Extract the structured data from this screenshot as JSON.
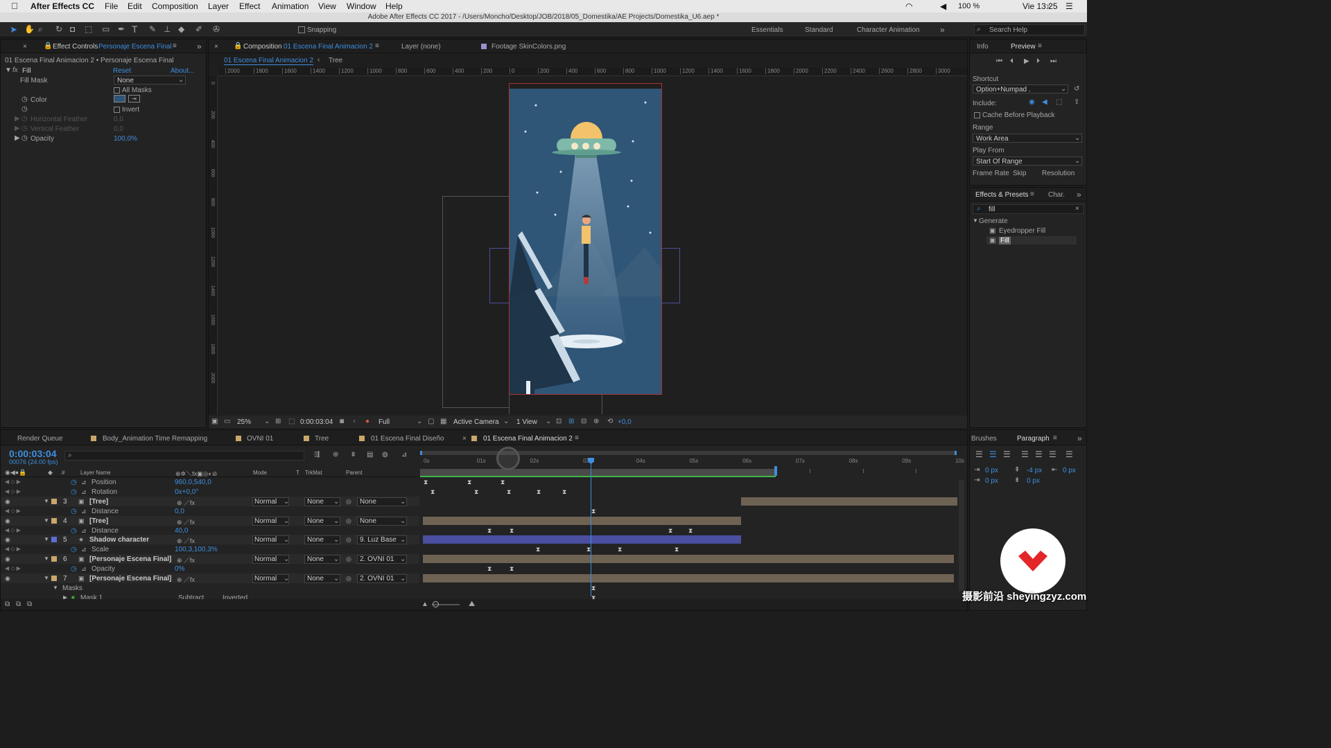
{
  "menubar": {
    "apple": "",
    "app": "After Effects CC",
    "items": [
      "File",
      "Edit",
      "Composition",
      "Layer",
      "Effect",
      "Animation",
      "View",
      "Window",
      "Help"
    ],
    "battery": "100 %",
    "clock": "Vie 13:25"
  },
  "titlebar": {
    "text": "Adobe After Effects CC 2017 - /Users/Moncho/Desktop/JOB/2018/05_Domestika/AE Projects/Domestika_U6.aep *"
  },
  "toolbar": {
    "snapping": "Snapping",
    "workspaces": [
      "Essentials",
      "Standard",
      "Character Animation"
    ],
    "search": "Search Help"
  },
  "effect_controls": {
    "tab_prefix": "Effect Controls",
    "tab_layer": "Personaje Escena Final",
    "breadcrumb": "01 Escena Final Animacion 2 • Personaje Escena Final",
    "fx_name": "Fill",
    "reset": "Reset",
    "about": "About...",
    "props": [
      {
        "label": "Fill Mask",
        "value": "None"
      },
      {
        "label": "All Masks"
      },
      {
        "label": "Color"
      },
      {
        "label": "Invert"
      },
      {
        "label": "Horizontal Feather",
        "value": "0,0"
      },
      {
        "label": "Vertical Feather",
        "value": "0,0"
      },
      {
        "label": "Opacity",
        "value": "100,0%"
      }
    ]
  },
  "comp_viewer": {
    "tab_prefix": "Composition",
    "tab_comp": "01 Escena Final Animacion 2",
    "layer_tab": "Layer (none)",
    "footage_tab": "Footage SkinColors.png",
    "breadcrumb_active": "01 Escena Final Animacion 2",
    "breadcrumb_next": "Tree",
    "ruler_labels": [
      "2000",
      "1800",
      "1600",
      "1400",
      "1200",
      "1000",
      "800",
      "600",
      "400",
      "200",
      "0",
      "200",
      "400",
      "600",
      "800",
      "1000",
      "1200",
      "1400",
      "1600",
      "1800",
      "2000",
      "2200",
      "2400",
      "2600",
      "2800",
      "3000"
    ],
    "vruler_labels": [
      "0",
      "200",
      "400",
      "600",
      "800",
      "1000",
      "1200",
      "1400",
      "1600",
      "1800",
      "2000"
    ],
    "zoom": "25%",
    "timecode": "0:00:03:04",
    "resolution": "Full",
    "camera": "Active Camera",
    "views": "1 View",
    "exposure": "+0,0"
  },
  "info_panel": {
    "tabs": [
      "Info",
      "Preview"
    ],
    "shortcut_label": "Shortcut",
    "shortcut_value": "Option+Numpad .",
    "include_label": "Include:",
    "cache": "Cache Before Playback",
    "range_label": "Range",
    "range_value": "Work Area",
    "playfrom_label": "Play From",
    "playfrom_value": "Start Of Range",
    "framerate": "Frame Rate",
    "skip": "Skip",
    "resolution": "Resolution"
  },
  "effects_presets": {
    "tab": "Effects & Presets",
    "tab2": "Char.",
    "search_value": "fill",
    "group": "Generate",
    "items": [
      "Eyedropper Fill",
      "Fill"
    ]
  },
  "timeline": {
    "tabs": [
      "Render Queue",
      "Body_Animation Time Remapping",
      "OVNI 01",
      "Tree",
      "01 Escena Final Diseño",
      "01 Escena Final Animacion 2"
    ],
    "timecode": "0:00:03:04",
    "frames": "00076 (24.00 fps)",
    "headers": {
      "layer_name": "Layer Name",
      "mode": "Mode",
      "t": "T",
      "trkmat": "TrkMat",
      "parent": "Parent"
    },
    "ticks": [
      "0s",
      "01s",
      "02s",
      "03s",
      "04s",
      "05s",
      "06s",
      "07s",
      "08s",
      "09s",
      "10s"
    ],
    "rows": [
      {
        "type": "prop",
        "name": "Position",
        "value": "960,0,540,0"
      },
      {
        "type": "prop",
        "name": "Rotation",
        "value": "0x+0,0°"
      },
      {
        "type": "layer",
        "num": "3",
        "name": "[Tree]",
        "mode": "Normal",
        "trkmat": "None",
        "parent": "None"
      },
      {
        "type": "prop",
        "name": "Distance",
        "value": "0,0"
      },
      {
        "type": "layer",
        "num": "4",
        "name": "[Tree]",
        "mode": "Normal",
        "trkmat": "None",
        "parent": "None"
      },
      {
        "type": "prop",
        "name": "Distance",
        "value": "40,0"
      },
      {
        "type": "layer",
        "num": "5",
        "name": "Shadow character",
        "mode": "Normal",
        "trkmat": "None",
        "parent": "9. Luz Base"
      },
      {
        "type": "prop",
        "name": "Scale",
        "value": "100,3,100,3%"
      },
      {
        "type": "layer",
        "num": "6",
        "name": "[Personaje Escena Final]",
        "mode": "Normal",
        "trkmat": "None",
        "parent": "2. OVNI 01"
      },
      {
        "type": "prop",
        "name": "Opacity",
        "value": "0%"
      },
      {
        "type": "layer",
        "num": "7",
        "name": "[Personaje Escena Final]",
        "mode": "Normal",
        "trkmat": "None",
        "parent": "2. OVNI 01"
      },
      {
        "type": "group",
        "name": "Masks"
      },
      {
        "type": "mask",
        "name": "Mask 1",
        "value": "Subtract",
        "extra": "Inverted"
      }
    ]
  },
  "paragraph": {
    "tabs": [
      "Brushes",
      "Paragraph"
    ],
    "fields": [
      "0 px",
      "-4 px",
      "0 px",
      "0 px",
      "0 px"
    ]
  },
  "watermark": "摄影前沿 sheyingzyz.com",
  "colors": {
    "accent": "#3d8fe0",
    "comp_bg": "#2f5577",
    "layer_bar": "#6e6253",
    "purple_bar": "#4a4fa0"
  }
}
